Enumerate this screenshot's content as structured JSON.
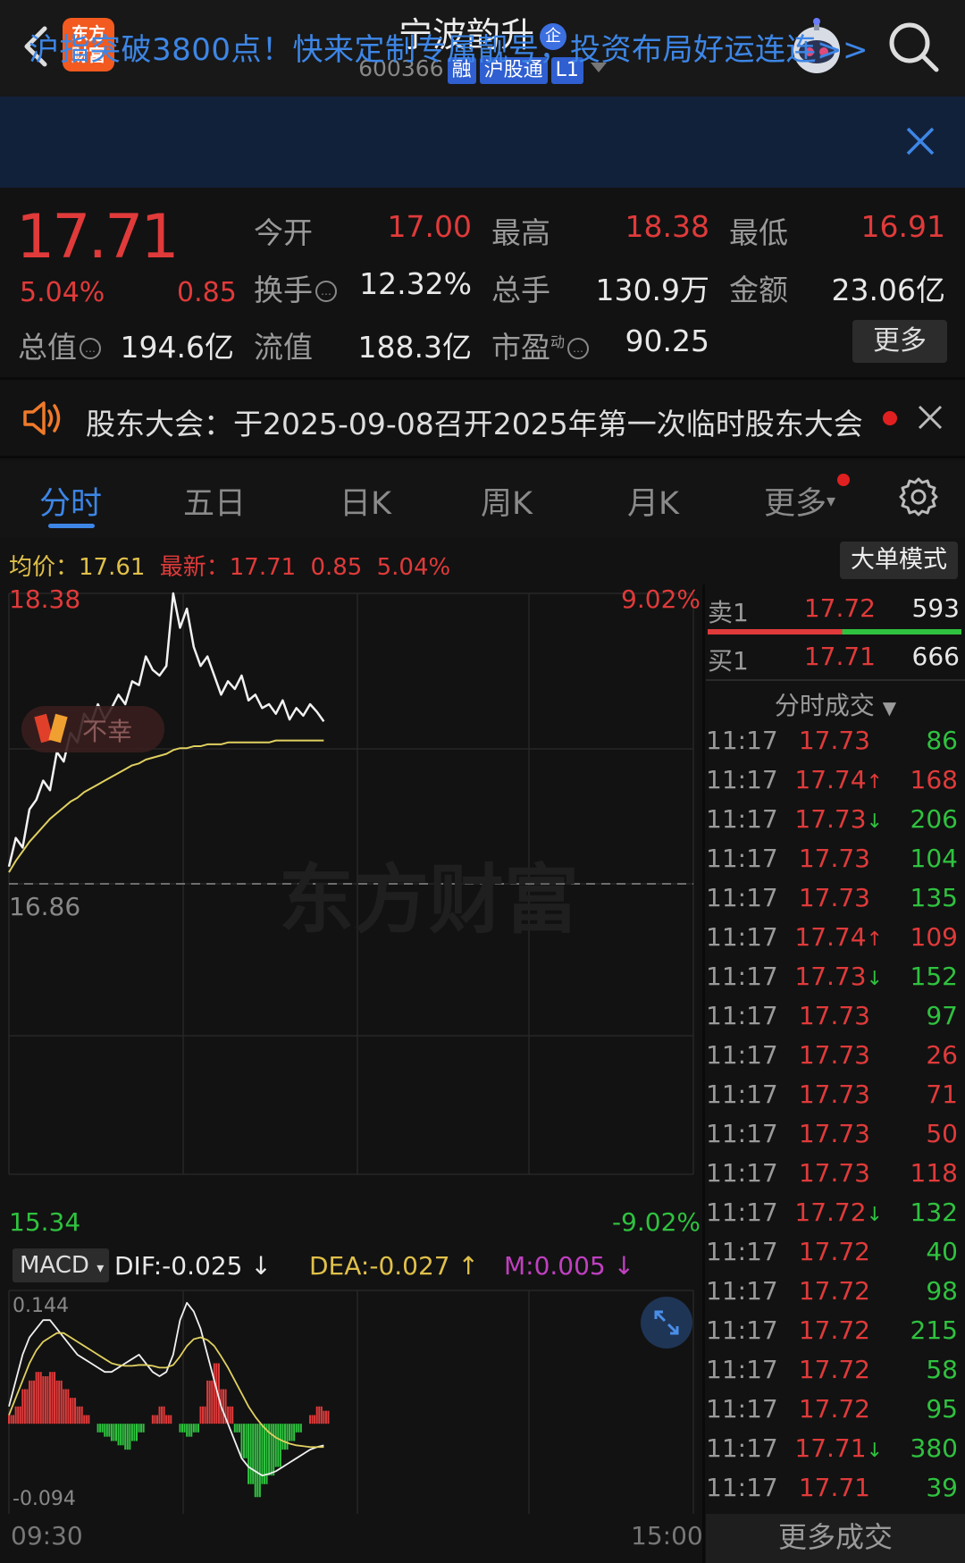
{
  "header": {
    "logo_line1": "东方",
    "logo_line2": "财富",
    "name": "宁波韵升",
    "name_badge": "企",
    "code": "600366",
    "tags": [
      "融",
      "沪股通",
      "L1"
    ]
  },
  "banner": {
    "text": "沪指突破3800点！快来定制专属靓号，投资布局好运连连>>"
  },
  "quote": {
    "price": "17.71",
    "change_pct": "5.04%",
    "change_val": "0.85",
    "open_label": "今开",
    "open": "17.00",
    "high_label": "最高",
    "high": "18.38",
    "low_label": "最低",
    "low": "16.91",
    "turnover_label": "换手",
    "turnover": "12.32%",
    "volume_label": "总手",
    "volume": "130.9万",
    "amount_label": "金额",
    "amount": "23.06亿",
    "mktcap_label": "总值",
    "mktcap": "194.6亿",
    "float_label": "流值",
    "float": "188.3亿",
    "pe_label": "市盈",
    "pe_sup": "动",
    "pe": "90.25",
    "more_label": "更多"
  },
  "notice": {
    "text": "股东大会：于2025-09-08召开2025年第一次临时股东大会"
  },
  "tabs": [
    "分时",
    "五日",
    "日K",
    "周K",
    "月K",
    "更多"
  ],
  "chart_header": {
    "avg_label": "均价：",
    "avg": "17.61",
    "latest_label": "最新：",
    "latest": "17.71",
    "latest_chg": "0.85",
    "latest_pct": "5.04%",
    "mode_label": "大单模式"
  },
  "chart_labels": {
    "y_top": "18.38",
    "y_top_pct": "9.02%",
    "y_mid": "16.86",
    "y_bottom": "15.34",
    "y_bottom_pct": "-9.02%",
    "watermark": "东方财富",
    "buff_label": "不幸",
    "time_start": "09:30",
    "time_end": "15:00"
  },
  "macd": {
    "button_label": "MACD",
    "dif": "DIF:-0.025",
    "dea": "DEA:-0.027",
    "m": "M:0.005",
    "top": "0.144",
    "bottom": "-0.094"
  },
  "orderbook": {
    "sell_label": "卖1",
    "sell_price": "17.72",
    "sell_vol": "593",
    "buy_label": "买1",
    "buy_price": "17.71",
    "buy_vol": "666",
    "buy_ratio": 0.53,
    "trades_title": "分时成交",
    "more_trades": "更多成交"
  },
  "trades": [
    {
      "time": "11:17",
      "price": "17.73",
      "dir": "",
      "vol": "86",
      "color": "green"
    },
    {
      "time": "11:17",
      "price": "17.74",
      "dir": "up",
      "vol": "168",
      "color": "red"
    },
    {
      "time": "11:17",
      "price": "17.73",
      "dir": "down",
      "vol": "206",
      "color": "green"
    },
    {
      "time": "11:17",
      "price": "17.73",
      "dir": "",
      "vol": "104",
      "color": "green"
    },
    {
      "time": "11:17",
      "price": "17.73",
      "dir": "",
      "vol": "135",
      "color": "green"
    },
    {
      "time": "11:17",
      "price": "17.74",
      "dir": "up",
      "vol": "109",
      "color": "red"
    },
    {
      "time": "11:17",
      "price": "17.73",
      "dir": "down",
      "vol": "152",
      "color": "green"
    },
    {
      "time": "11:17",
      "price": "17.73",
      "dir": "",
      "vol": "97",
      "color": "green"
    },
    {
      "time": "11:17",
      "price": "17.73",
      "dir": "",
      "vol": "26",
      "color": "red"
    },
    {
      "time": "11:17",
      "price": "17.73",
      "dir": "",
      "vol": "71",
      "color": "red"
    },
    {
      "time": "11:17",
      "price": "17.73",
      "dir": "",
      "vol": "50",
      "color": "red"
    },
    {
      "time": "11:17",
      "price": "17.73",
      "dir": "",
      "vol": "118",
      "color": "red"
    },
    {
      "time": "11:17",
      "price": "17.72",
      "dir": "down",
      "vol": "132",
      "color": "green"
    },
    {
      "time": "11:17",
      "price": "17.72",
      "dir": "",
      "vol": "40",
      "color": "green"
    },
    {
      "time": "11:17",
      "price": "17.72",
      "dir": "",
      "vol": "98",
      "color": "green"
    },
    {
      "time": "11:17",
      "price": "17.72",
      "dir": "",
      "vol": "215",
      "color": "green"
    },
    {
      "time": "11:17",
      "price": "17.72",
      "dir": "",
      "vol": "58",
      "color": "green"
    },
    {
      "time": "11:17",
      "price": "17.72",
      "dir": "",
      "vol": "95",
      "color": "green"
    },
    {
      "time": "11:17",
      "price": "17.71",
      "dir": "down",
      "vol": "380",
      "color": "green"
    },
    {
      "time": "11:17",
      "price": "17.71",
      "dir": "",
      "vol": "39",
      "color": "green"
    }
  ],
  "chart_data": {
    "type": "line",
    "ylim": [
      15.34,
      18.38
    ],
    "prev_close": 16.86,
    "price_series": [
      16.95,
      17.1,
      17.05,
      17.25,
      17.3,
      17.4,
      17.35,
      17.55,
      17.5,
      17.65,
      17.6,
      17.75,
      17.7,
      17.8,
      17.72,
      17.78,
      17.85,
      17.8,
      17.92,
      17.9,
      18.05,
      17.98,
      17.95,
      18.0,
      18.38,
      18.2,
      18.3,
      18.1,
      18.0,
      18.05,
      17.95,
      17.85,
      17.92,
      17.88,
      17.95,
      17.82,
      17.85,
      17.78,
      17.8,
      17.75,
      17.82,
      17.72,
      17.78,
      17.74,
      17.8,
      17.76,
      17.71
    ],
    "avg_series": [
      16.92,
      16.98,
      17.03,
      17.08,
      17.12,
      17.16,
      17.2,
      17.23,
      17.26,
      17.29,
      17.31,
      17.34,
      17.36,
      17.38,
      17.4,
      17.42,
      17.44,
      17.46,
      17.48,
      17.49,
      17.51,
      17.52,
      17.53,
      17.54,
      17.56,
      17.57,
      17.57,
      17.58,
      17.58,
      17.59,
      17.59,
      17.59,
      17.6,
      17.6,
      17.6,
      17.6,
      17.6,
      17.6,
      17.6,
      17.61,
      17.61,
      17.61,
      17.61,
      17.61,
      17.61,
      17.61,
      17.61
    ],
    "macd_ylim": [
      -0.094,
      0.144
    ],
    "macd_hist": [
      0.01,
      0.02,
      0.04,
      0.05,
      0.06,
      0.055,
      0.06,
      0.05,
      0.04,
      0.03,
      0.02,
      0.01,
      0.0,
      -0.01,
      -0.015,
      -0.02,
      -0.025,
      -0.03,
      -0.02,
      -0.01,
      0.0,
      0.01,
      0.02,
      0.01,
      0.0,
      -0.01,
      -0.015,
      -0.01,
      0.02,
      0.05,
      0.07,
      0.04,
      0.02,
      -0.01,
      -0.04,
      -0.07,
      -0.085,
      -0.07,
      -0.06,
      -0.05,
      -0.03,
      -0.02,
      -0.01,
      0.0,
      0.01,
      0.02,
      0.015
    ],
    "dif_series": [
      0.02,
      0.05,
      0.08,
      0.1,
      0.11,
      0.12,
      0.12,
      0.11,
      0.1,
      0.09,
      0.08,
      0.075,
      0.07,
      0.065,
      0.06,
      0.06,
      0.065,
      0.07,
      0.075,
      0.08,
      0.07,
      0.06,
      0.055,
      0.06,
      0.08,
      0.12,
      0.14,
      0.13,
      0.11,
      0.08,
      0.05,
      0.02,
      0.0,
      -0.02,
      -0.04,
      -0.05,
      -0.055,
      -0.06,
      -0.058,
      -0.055,
      -0.05,
      -0.045,
      -0.04,
      -0.035,
      -0.03,
      -0.027,
      -0.025
    ],
    "dea_series": [
      0.01,
      0.03,
      0.05,
      0.07,
      0.085,
      0.095,
      0.1,
      0.105,
      0.105,
      0.1,
      0.095,
      0.09,
      0.085,
      0.08,
      0.075,
      0.07,
      0.068,
      0.067,
      0.067,
      0.068,
      0.068,
      0.067,
      0.065,
      0.065,
      0.068,
      0.078,
      0.09,
      0.098,
      0.1,
      0.097,
      0.09,
      0.078,
      0.065,
      0.05,
      0.035,
      0.02,
      0.008,
      -0.002,
      -0.01,
      -0.016,
      -0.02,
      -0.023,
      -0.025,
      -0.026,
      -0.027,
      -0.027,
      -0.027
    ]
  }
}
